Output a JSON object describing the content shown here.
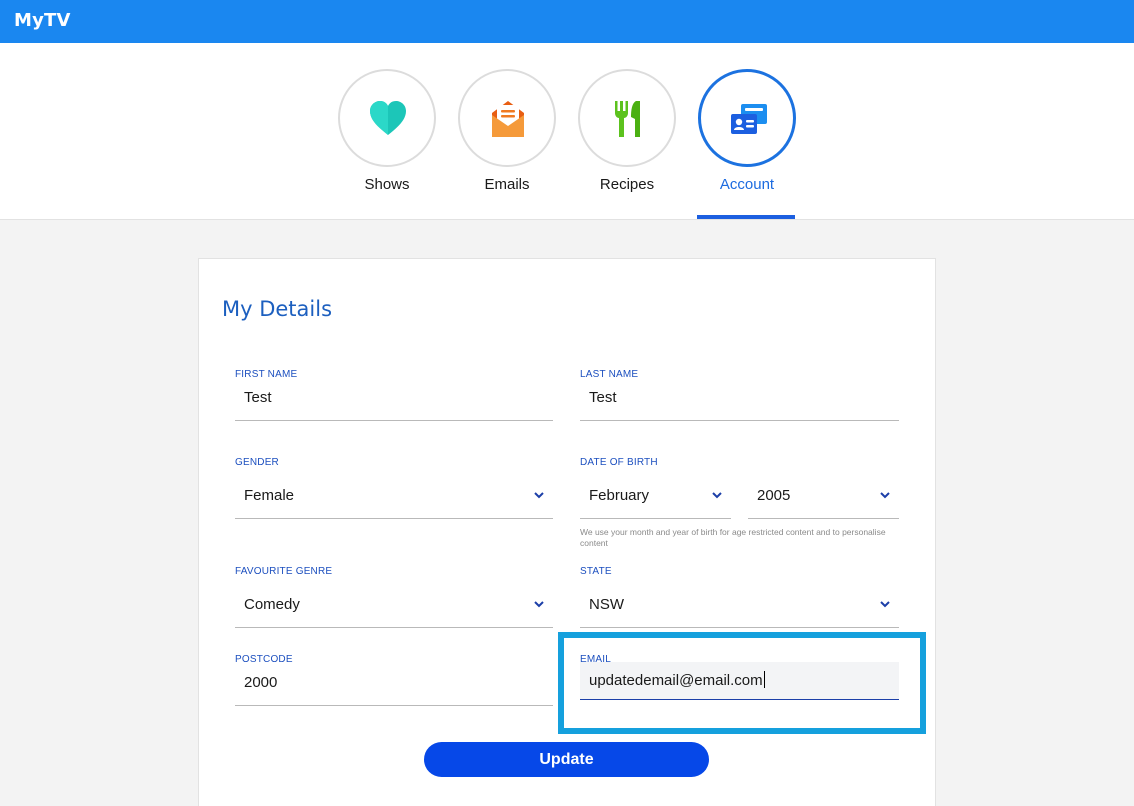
{
  "app": {
    "title": "MyTV"
  },
  "nav": {
    "items": [
      {
        "label": "Shows",
        "icon": "heart-icon",
        "color": "#1cc6b8"
      },
      {
        "label": "Emails",
        "icon": "envelope-icon",
        "color": "#f07a22"
      },
      {
        "label": "Recipes",
        "icon": "utensils-icon",
        "color": "#5cc21e"
      },
      {
        "label": "Account",
        "icon": "id-card-icon",
        "color": "#1c5fe0"
      }
    ],
    "active": "Account"
  },
  "details": {
    "title": "My Details",
    "first_name": {
      "label": "FIRST NAME",
      "value": "Test"
    },
    "last_name": {
      "label": "LAST NAME",
      "value": "Test"
    },
    "gender": {
      "label": "GENDER",
      "value": "Female"
    },
    "dob": {
      "label": "DATE OF BIRTH",
      "month": "February",
      "year": "2005",
      "hint": "We use your month and year of birth for age restricted content and to personalise content"
    },
    "genre": {
      "label": "FAVOURITE GENRE",
      "value": "Comedy"
    },
    "state": {
      "label": "STATE",
      "value": "NSW"
    },
    "postcode": {
      "label": "POSTCODE",
      "value": "2000"
    },
    "email": {
      "label": "EMAIL",
      "value": "updatedemail@email.com"
    },
    "update_label": "Update"
  },
  "colors": {
    "topbar": "#1a87f0",
    "accent": "#1c5fe0",
    "button": "#0648e8",
    "highlight": "#15a0dd"
  }
}
